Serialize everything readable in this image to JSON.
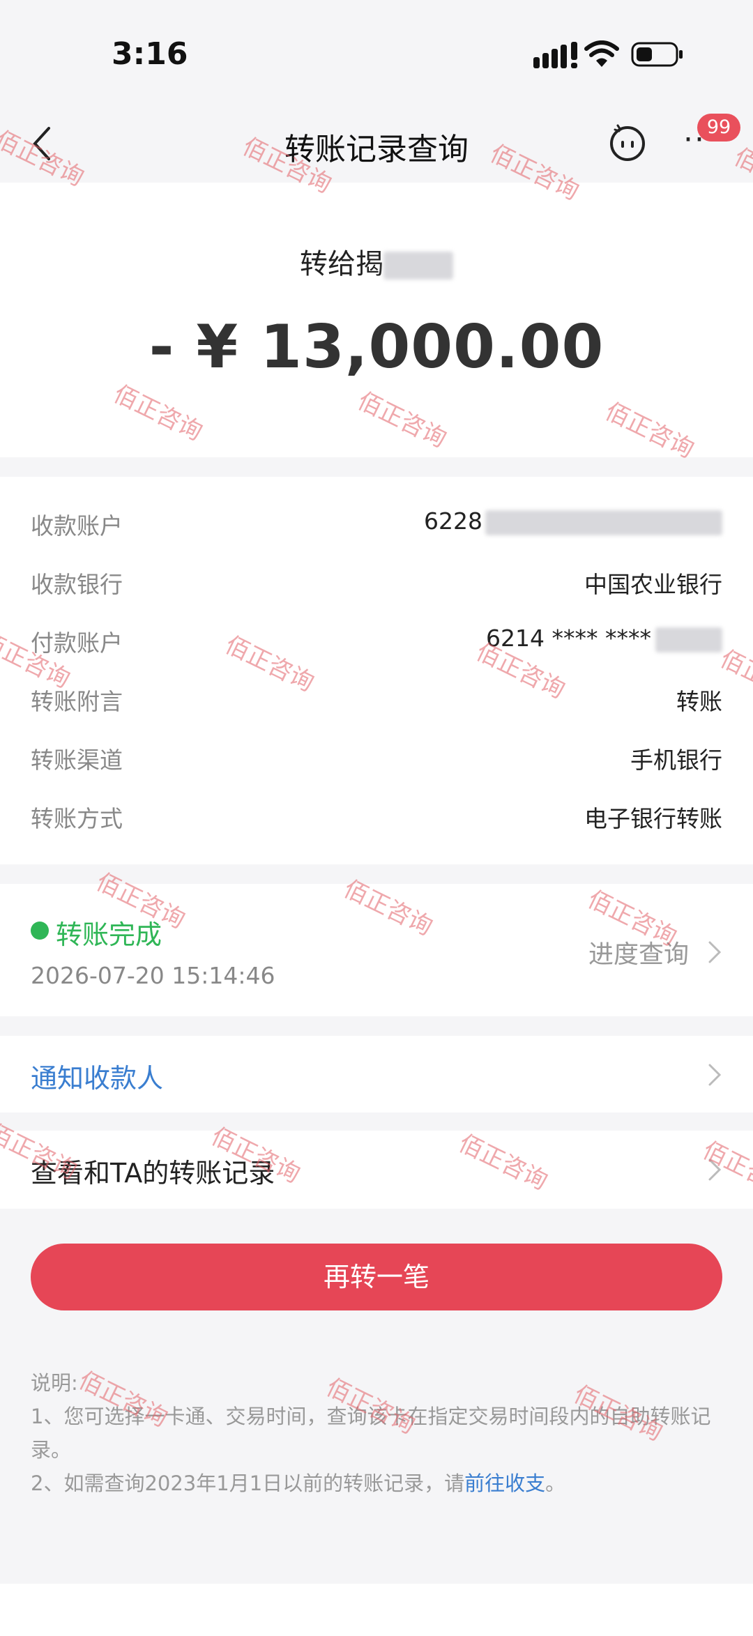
{
  "status_bar": {
    "time": "3:16"
  },
  "nav": {
    "title": "转账记录查询",
    "badge": "99",
    "more_label": "···"
  },
  "amount_card": {
    "to_prefix": "转给揭",
    "amount": "- ¥ 13,000.00"
  },
  "details": {
    "receiver_account": {
      "label": "收款账户",
      "value": "6228"
    },
    "receiver_bank": {
      "label": "收款银行",
      "value": "中国农业银行"
    },
    "payer_account": {
      "label": "付款账户",
      "value": "6214 **** ****"
    },
    "memo": {
      "label": "转账附言",
      "value": "转账"
    },
    "channel": {
      "label": "转账渠道",
      "value": "手机银行"
    },
    "method": {
      "label": "转账方式",
      "value": "电子银行转账"
    }
  },
  "status": {
    "text": "转账完成",
    "time": "2026-07-20 15:14:46",
    "progress_label": "进度查询",
    "color": "#2fb656"
  },
  "notify": {
    "label": "通知收款人"
  },
  "history": {
    "label": "查看和TA的转账记录"
  },
  "cta": {
    "label": "再转一笔",
    "color": "#e64656"
  },
  "notes": {
    "title": "说明:",
    "line1": "1、您可选择一卡通、交易时间，查询该卡在指定交易时间段内的自助转账记录。",
    "line2_prefix": "2、如需查询2023年1月1日以前的转账记录，请",
    "line2_link": "前往收支",
    "line2_suffix": "。"
  },
  "watermark": {
    "text": "佰正咨询",
    "color": "#e26068"
  }
}
